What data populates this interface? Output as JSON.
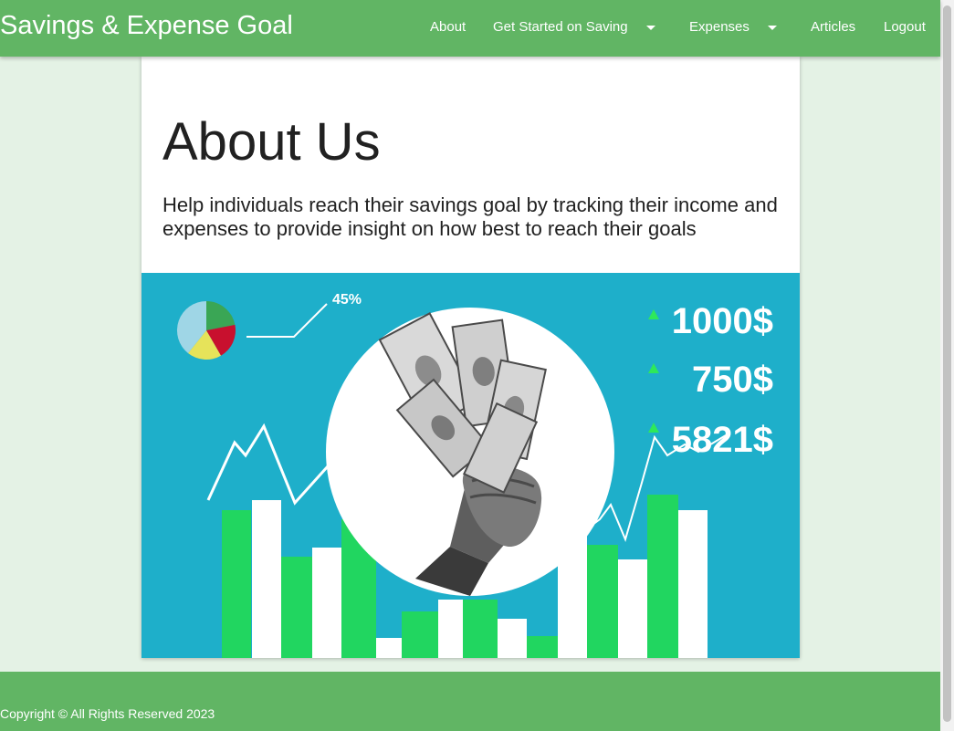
{
  "nav": {
    "brand": "Savings & Expense Goal",
    "items": [
      {
        "label": "About"
      },
      {
        "label": "Get Started on Saving"
      },
      {
        "label": "Expenses"
      },
      {
        "label": "Articles"
      },
      {
        "label": "Logout"
      }
    ]
  },
  "about": {
    "title": "About Us",
    "description": "Help individuals reach their savings goal by tracking their income and expenses to provide insight on how best to reach their goals"
  },
  "hero": {
    "percent_label": "45%",
    "amounts": [
      "1000$",
      "750$",
      "5821$"
    ],
    "colors": {
      "background": "#1eafca",
      "bar_green": "#21d660",
      "bar_white": "#ffffff",
      "arrow": "#2ee85a"
    }
  },
  "footer": {
    "copyright": "Copyright © All Rights Reserved 2023"
  },
  "theme": {
    "nav_color": "#61b564",
    "page_background": "#e4f2e5"
  }
}
